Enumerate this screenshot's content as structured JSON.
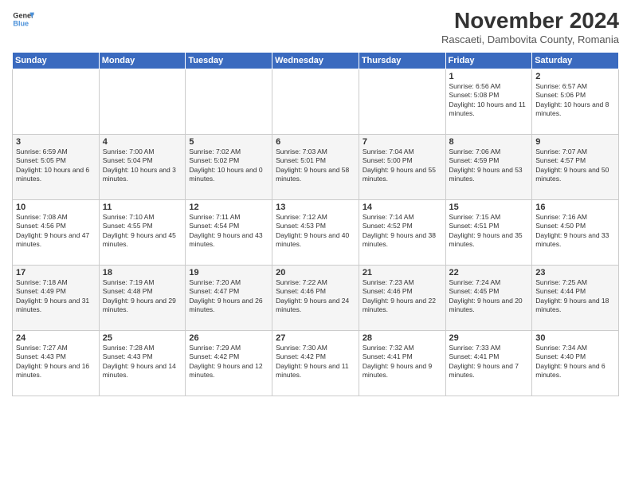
{
  "logo": {
    "line1": "General",
    "line2": "Blue"
  },
  "title": "November 2024",
  "location": "Rascaeti, Dambovita County, Romania",
  "weekdays": [
    "Sunday",
    "Monday",
    "Tuesday",
    "Wednesday",
    "Thursday",
    "Friday",
    "Saturday"
  ],
  "rows": [
    [
      {
        "day": "",
        "info": ""
      },
      {
        "day": "",
        "info": ""
      },
      {
        "day": "",
        "info": ""
      },
      {
        "day": "",
        "info": ""
      },
      {
        "day": "",
        "info": ""
      },
      {
        "day": "1",
        "info": "Sunrise: 6:56 AM\nSunset: 5:08 PM\nDaylight: 10 hours and 11 minutes."
      },
      {
        "day": "2",
        "info": "Sunrise: 6:57 AM\nSunset: 5:06 PM\nDaylight: 10 hours and 8 minutes."
      }
    ],
    [
      {
        "day": "3",
        "info": "Sunrise: 6:59 AM\nSunset: 5:05 PM\nDaylight: 10 hours and 6 minutes."
      },
      {
        "day": "4",
        "info": "Sunrise: 7:00 AM\nSunset: 5:04 PM\nDaylight: 10 hours and 3 minutes."
      },
      {
        "day": "5",
        "info": "Sunrise: 7:02 AM\nSunset: 5:02 PM\nDaylight: 10 hours and 0 minutes."
      },
      {
        "day": "6",
        "info": "Sunrise: 7:03 AM\nSunset: 5:01 PM\nDaylight: 9 hours and 58 minutes."
      },
      {
        "day": "7",
        "info": "Sunrise: 7:04 AM\nSunset: 5:00 PM\nDaylight: 9 hours and 55 minutes."
      },
      {
        "day": "8",
        "info": "Sunrise: 7:06 AM\nSunset: 4:59 PM\nDaylight: 9 hours and 53 minutes."
      },
      {
        "day": "9",
        "info": "Sunrise: 7:07 AM\nSunset: 4:57 PM\nDaylight: 9 hours and 50 minutes."
      }
    ],
    [
      {
        "day": "10",
        "info": "Sunrise: 7:08 AM\nSunset: 4:56 PM\nDaylight: 9 hours and 47 minutes."
      },
      {
        "day": "11",
        "info": "Sunrise: 7:10 AM\nSunset: 4:55 PM\nDaylight: 9 hours and 45 minutes."
      },
      {
        "day": "12",
        "info": "Sunrise: 7:11 AM\nSunset: 4:54 PM\nDaylight: 9 hours and 43 minutes."
      },
      {
        "day": "13",
        "info": "Sunrise: 7:12 AM\nSunset: 4:53 PM\nDaylight: 9 hours and 40 minutes."
      },
      {
        "day": "14",
        "info": "Sunrise: 7:14 AM\nSunset: 4:52 PM\nDaylight: 9 hours and 38 minutes."
      },
      {
        "day": "15",
        "info": "Sunrise: 7:15 AM\nSunset: 4:51 PM\nDaylight: 9 hours and 35 minutes."
      },
      {
        "day": "16",
        "info": "Sunrise: 7:16 AM\nSunset: 4:50 PM\nDaylight: 9 hours and 33 minutes."
      }
    ],
    [
      {
        "day": "17",
        "info": "Sunrise: 7:18 AM\nSunset: 4:49 PM\nDaylight: 9 hours and 31 minutes."
      },
      {
        "day": "18",
        "info": "Sunrise: 7:19 AM\nSunset: 4:48 PM\nDaylight: 9 hours and 29 minutes."
      },
      {
        "day": "19",
        "info": "Sunrise: 7:20 AM\nSunset: 4:47 PM\nDaylight: 9 hours and 26 minutes."
      },
      {
        "day": "20",
        "info": "Sunrise: 7:22 AM\nSunset: 4:46 PM\nDaylight: 9 hours and 24 minutes."
      },
      {
        "day": "21",
        "info": "Sunrise: 7:23 AM\nSunset: 4:46 PM\nDaylight: 9 hours and 22 minutes."
      },
      {
        "day": "22",
        "info": "Sunrise: 7:24 AM\nSunset: 4:45 PM\nDaylight: 9 hours and 20 minutes."
      },
      {
        "day": "23",
        "info": "Sunrise: 7:25 AM\nSunset: 4:44 PM\nDaylight: 9 hours and 18 minutes."
      }
    ],
    [
      {
        "day": "24",
        "info": "Sunrise: 7:27 AM\nSunset: 4:43 PM\nDaylight: 9 hours and 16 minutes."
      },
      {
        "day": "25",
        "info": "Sunrise: 7:28 AM\nSunset: 4:43 PM\nDaylight: 9 hours and 14 minutes."
      },
      {
        "day": "26",
        "info": "Sunrise: 7:29 AM\nSunset: 4:42 PM\nDaylight: 9 hours and 12 minutes."
      },
      {
        "day": "27",
        "info": "Sunrise: 7:30 AM\nSunset: 4:42 PM\nDaylight: 9 hours and 11 minutes."
      },
      {
        "day": "28",
        "info": "Sunrise: 7:32 AM\nSunset: 4:41 PM\nDaylight: 9 hours and 9 minutes."
      },
      {
        "day": "29",
        "info": "Sunrise: 7:33 AM\nSunset: 4:41 PM\nDaylight: 9 hours and 7 minutes."
      },
      {
        "day": "30",
        "info": "Sunrise: 7:34 AM\nSunset: 4:40 PM\nDaylight: 9 hours and 6 minutes."
      }
    ]
  ]
}
